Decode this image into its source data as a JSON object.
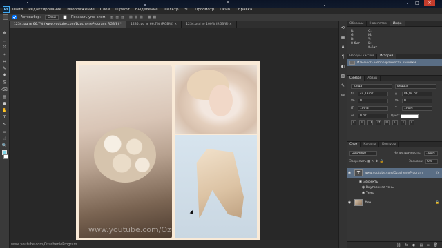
{
  "app": {
    "logo_text": "Ps"
  },
  "menu": [
    "Файл",
    "Редактирование",
    "Изображение",
    "Слои",
    "Шрифт",
    "Выделение",
    "Фильтр",
    "3D",
    "Просмотр",
    "Окно",
    "Справка"
  ],
  "window_controls": {
    "minimize": "–",
    "maximize": "□",
    "close": "✕"
  },
  "options": {
    "auto_select_label": "Автовыбор:",
    "auto_select_value": "Слой",
    "show_transform_label": "Показать упр. элем."
  },
  "doc_tabs": [
    {
      "label": "1234.jpg @ 66,7% (www.youtube.com/DzuchenieProgram, RGB/8) *",
      "active": true,
      "close": "×"
    },
    {
      "label": "1235.jpg @ 66,7% (RGB/8) ×",
      "active": false
    },
    {
      "label": "1234.psd @ 100% (RGB/8) ×",
      "active": false
    }
  ],
  "tools": [
    "✥",
    "⬚",
    "ʘ",
    "⌖",
    "⌗",
    "✎",
    "✚",
    "⎘",
    "⌫",
    "▤",
    "●",
    "✋",
    "T",
    "↖",
    "▭",
    "☝",
    "🔍"
  ],
  "canvas": {
    "watermark": "www.youtube.com/OzuchenieProgram"
  },
  "status": {
    "text": "www.youtube.com/OzuchenieProgram"
  },
  "right_panels": {
    "top_tabs": [
      "Образцы",
      "Навигатор",
      "Инфо"
    ],
    "info_labels": [
      "R:",
      "G:",
      "B:",
      "8-бит",
      "C:",
      "M:",
      "Y:",
      "K:",
      "8-бит"
    ],
    "history_tabs": [
      "Наборы кистей",
      "История"
    ],
    "history_items": [
      {
        "label": "Изменить непрозрачность заливки",
        "selected": true
      }
    ],
    "char_tabs": [
      "Символ",
      "Абзац"
    ],
    "font_family": "Tunga",
    "font_style": "Regular",
    "font_size": "44,13 пт",
    "leading": "86,94 пт",
    "tracking": "0",
    "kerning": "0",
    "vert_scale": "100%",
    "horiz_scale": "100%",
    "baseline": "0 пт",
    "color_label": "Цвет:",
    "format_buttons": [
      "T",
      "T",
      "TT",
      "Tt",
      "T¹",
      "T₁",
      "T",
      "T"
    ],
    "layers_tabs": [
      "Слои",
      "Каналы",
      "Контуры"
    ],
    "blend_mode": "Обычные",
    "opacity_label": "Непрозрачность:",
    "opacity_value": "100%",
    "lock_label": "Закрепить:",
    "fill_label": "Заливка:",
    "fill_value": "0%",
    "layers": [
      {
        "name": "www.youtube.com/OzuchenieProgram",
        "type": "text",
        "selected": true,
        "fx": "fx"
      },
      {
        "name": "Эффекты",
        "type": "effect-group"
      },
      {
        "name": "Внутренняя тень",
        "type": "effect"
      },
      {
        "name": "Тень",
        "type": "effect"
      },
      {
        "name": "Фон",
        "type": "image"
      }
    ],
    "layers_footer": [
      "⛓",
      "fx",
      "◐",
      "▤",
      "▫",
      "🗑"
    ]
  },
  "colors": {
    "accent_selection": "#5a6e85",
    "fg_swatch": "#7fd6e8",
    "bg_swatch": "#ffffff"
  }
}
